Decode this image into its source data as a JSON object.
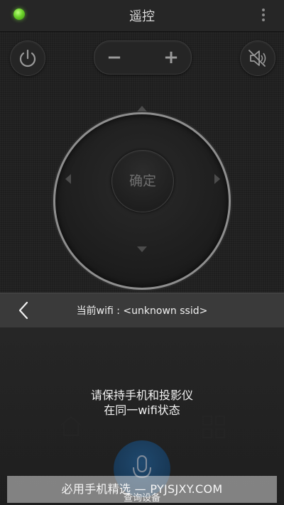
{
  "app": {
    "title": "遥控"
  },
  "remote": {
    "volume_minus": "−",
    "volume_plus": "+",
    "ok_label": "确定"
  },
  "sheet": {
    "header_title": "当前wifi : <unknown ssid>",
    "message_line1": "请保持手机和投影仪",
    "message_line2": "在同一wifi状态",
    "query_label": "查询设备"
  },
  "watermark": {
    "text": "必用手机精选 — PYJSJXY.COM"
  },
  "icons": {
    "status": "status-led-icon",
    "menu": "more-vert-icon",
    "power": "power-icon",
    "mute": "volume-mute-icon",
    "home": "home-icon",
    "apps": "apps-grid-icon",
    "back": "chevron-left-icon",
    "mic": "microphone-icon"
  },
  "colors": {
    "status_led": "#6bd12a",
    "accent_blue": "#1f6bb0"
  }
}
